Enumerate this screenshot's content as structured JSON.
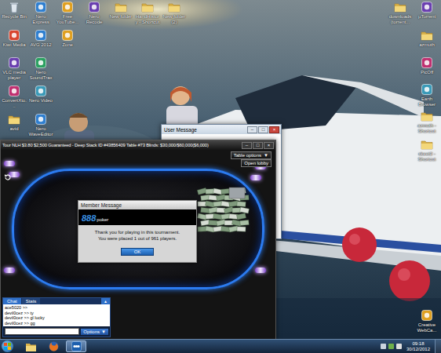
{
  "desktop": {
    "icons": [
      {
        "label": "Recycle Bin",
        "kind": "bin"
      },
      {
        "label": "Nero Express",
        "kind": "app"
      },
      {
        "label": "Free YouTube...",
        "kind": "app"
      },
      {
        "label": "Nero Recode",
        "kind": "app"
      },
      {
        "label": "New folder",
        "kind": "folder"
      },
      {
        "label": "HandHistory - Shortcut",
        "kind": "folder"
      },
      {
        "label": "New folder (2)",
        "kind": "folder"
      },
      {
        "label": "Kiwi Media",
        "kind": "app"
      },
      {
        "label": "AVG 2012",
        "kind": "app"
      },
      {
        "label": "Zone",
        "kind": "app"
      },
      {
        "label": "VLC media player",
        "kind": "app"
      },
      {
        "label": "Nero SoundTrax",
        "kind": "app"
      },
      {
        "label": "ConvertXto...",
        "kind": "app"
      },
      {
        "label": "Nero Video",
        "kind": "app"
      },
      {
        "label": "avid",
        "kind": "folder"
      },
      {
        "label": "Nero WaveEditor",
        "kind": "app"
      },
      {
        "label": "downloads (torrent...",
        "kind": "folder"
      },
      {
        "label": "µTorrent",
        "kind": "app"
      },
      {
        "label": "azmuth",
        "kind": "folder"
      },
      {
        "label": "PicOff",
        "kind": "app"
      },
      {
        "label": "Earth Browser",
        "kind": "app"
      },
      {
        "label": "azmuth - Shortcut",
        "kind": "folder"
      },
      {
        "label": "skeet2 - Shortcut",
        "kind": "folder"
      },
      {
        "label": "Creative WebCa...",
        "kind": "app"
      }
    ]
  },
  "user_message": {
    "title": "User Message",
    "controls": [
      "–",
      "□",
      "×"
    ]
  },
  "poker_window": {
    "title": "Tour NLH $3.80 $2,500 Guaranteed - Deep Stack ID #43856409 Table #73 Blinds: $30,000/$60,000($6,000)",
    "controls": [
      "–",
      "□",
      "×"
    ],
    "table_options": "Table options",
    "table_options_arrow": "▼",
    "open_lobby": "Open lobby",
    "chat": {
      "tabs": [
        {
          "label": "Chat",
          "selected": true
        },
        {
          "label": "Stats",
          "selected": false
        }
      ],
      "expand": "▲",
      "lines": [
        "ace5020 >>",
        "devil0cez >> ty",
        "devil0cez >> gl lucky",
        "devil0cez >> gg"
      ],
      "options": "Options",
      "options_arrow": "▼"
    }
  },
  "member_message": {
    "title": "Member Message",
    "logo_number": "888",
    "logo_word": "poker",
    "message_1": "Thank you for playing in this tournament.",
    "message_2": "You were placed 1 out of 961 players.",
    "ok_button": "OK"
  },
  "taskbar": {
    "buttons": [
      {
        "kind": "explorer",
        "selected": false
      },
      {
        "kind": "firefox",
        "selected": false
      },
      {
        "kind": "poker",
        "selected": true
      }
    ],
    "time": "09:18",
    "date": "30/12/2012"
  }
}
